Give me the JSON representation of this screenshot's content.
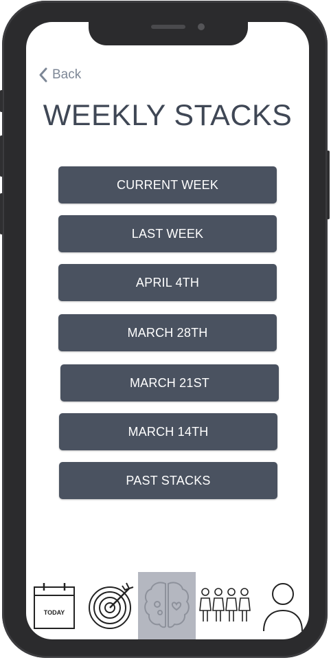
{
  "back": {
    "label": "Back"
  },
  "page": {
    "title": "WEEKLY STACKS"
  },
  "stacks": [
    {
      "label": "CURRENT WEEK"
    },
    {
      "label": "LAST WEEK"
    },
    {
      "label": "APRIL 4TH"
    },
    {
      "label": "MARCH 28TH"
    },
    {
      "label": "MARCH 21ST"
    },
    {
      "label": "MARCH 14TH"
    },
    {
      "label": "PAST STACKS"
    }
  ],
  "nav": {
    "items": [
      {
        "name": "today",
        "icon": "calendar-icon",
        "label": "TODAY"
      },
      {
        "name": "goals",
        "icon": "target-icon"
      },
      {
        "name": "brain",
        "icon": "brain-icon",
        "active": true
      },
      {
        "name": "community",
        "icon": "people-icon"
      },
      {
        "name": "profile",
        "icon": "person-icon"
      }
    ]
  },
  "colors": {
    "button_bg": "#4a5260",
    "title": "#3f4755",
    "back": "#7d8796",
    "nav_active_bg": "#b4b7c0"
  }
}
